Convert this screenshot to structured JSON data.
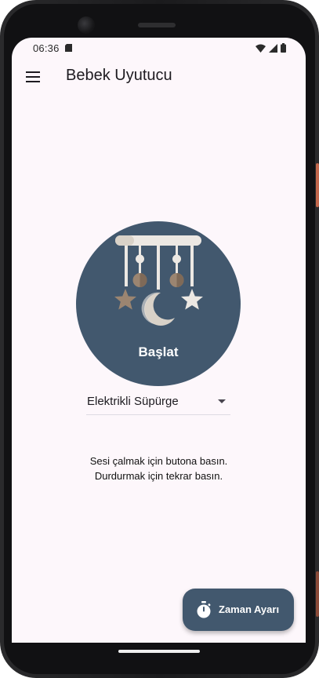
{
  "status_bar": {
    "time": "06:36",
    "icons": [
      "sim-card-icon",
      "wifi-icon",
      "signal-icon",
      "battery-icon"
    ]
  },
  "app_bar": {
    "menu_icon": "hamburger-menu-icon",
    "title": "Bebek Uyutucu"
  },
  "hero": {
    "image": "baby-crib-mobile-illustration",
    "label": "Başlat"
  },
  "sound_selector": {
    "selected": "Elektrikli Süpürge"
  },
  "instructions": {
    "line1": "Sesi çalmak için butona basın.",
    "line2": "Durdurmak için tekrar basın."
  },
  "fab": {
    "icon": "timer-icon",
    "label": "Zaman Ayarı"
  },
  "colors": {
    "primary": "#42586e",
    "background": "#fdf7fb",
    "on_surface": "#1d1b20"
  }
}
